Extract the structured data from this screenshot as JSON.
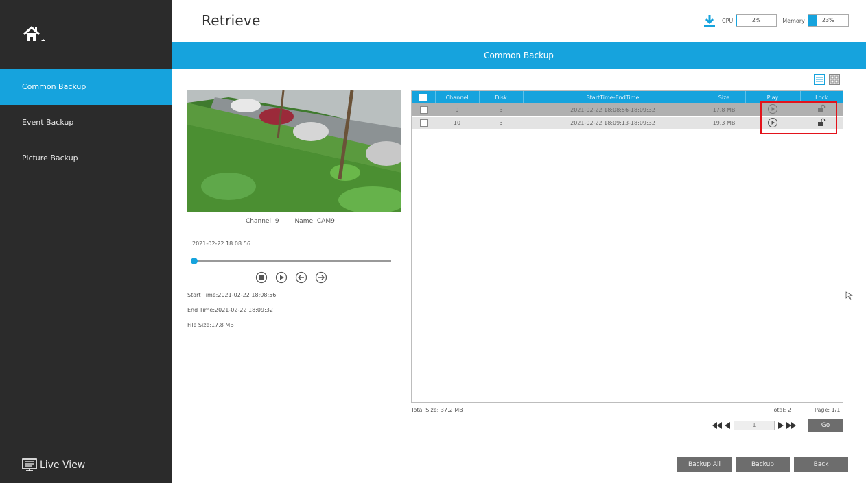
{
  "header": {
    "title": "Retrieve",
    "cpu_label": "CPU",
    "cpu_value": "2%",
    "memory_label": "Memory",
    "memory_value": "23%"
  },
  "banner": {
    "title": "Common Backup"
  },
  "sidebar": {
    "items": [
      {
        "label": "Common Backup",
        "active": true
      },
      {
        "label": "Event Backup",
        "active": false
      },
      {
        "label": "Picture Backup",
        "active": false
      }
    ],
    "live_view": "Live View"
  },
  "preview": {
    "channel": "Channel: 9",
    "name": "Name: CAM9",
    "current_time": "2021-02-22 18:08:56",
    "start_time": "Start Time:2021-02-22 18:08:56",
    "end_time": "End Time:2021-02-22 18:09:32",
    "file_size": "File Size:17.8 MB",
    "progress_fraction": 0.0
  },
  "table": {
    "columns": [
      "Channel",
      "Disk",
      "StartTime-EndTime",
      "Size",
      "Play",
      "Lock"
    ],
    "rows": [
      {
        "channel": "9",
        "disk": "3",
        "time": "2021-02-22 18:08:56-18:09:32",
        "size": "17.8 MB",
        "selected": true
      },
      {
        "channel": "10",
        "disk": "3",
        "time": "2021-02-22 18:09:13-18:09:32",
        "size": "19.3 MB",
        "selected": false
      }
    ]
  },
  "footer": {
    "total_size": "Total Size: 37.2 MB",
    "total": "Total: 2",
    "page": "Page: 1/1",
    "page_input": "1",
    "go": "Go",
    "backup_all": "Backup All",
    "backup": "Backup",
    "back": "Back"
  },
  "colors": {
    "accent": "#16a3dd",
    "sidebar": "#2b2b2b",
    "highlight": "#e3131b",
    "button": "#6d6d6d"
  },
  "icons": [
    "home-icon",
    "download-icon",
    "list-view-icon",
    "grid-view-icon",
    "stop-icon",
    "play-icon",
    "rewind-icon",
    "forward-icon",
    "lock-icon",
    "monitor-icon"
  ]
}
